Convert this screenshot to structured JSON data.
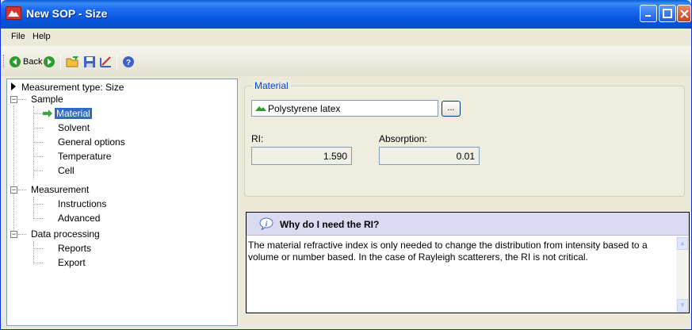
{
  "window": {
    "title": "New SOP - Size"
  },
  "menu": [
    "File",
    "Help"
  ],
  "toolbar": {
    "back_label": "Back"
  },
  "tree": {
    "root": "Measurement type: Size",
    "sample": "Sample",
    "sample_items": [
      "Material",
      "Solvent",
      "General options",
      "Temperature",
      "Cell"
    ],
    "measurement": "Measurement",
    "measurement_items": [
      "Instructions",
      "Advanced"
    ],
    "data_processing": "Data processing",
    "data_processing_items": [
      "Reports",
      "Export"
    ],
    "selected": "Material"
  },
  "material": {
    "group_label": "Material",
    "value": "Polystyrene latex",
    "browse_label": "...",
    "ri_label": "RI:",
    "ri_value": "1.590",
    "absorption_label": "Absorption:",
    "absorption_value": "0.01"
  },
  "help": {
    "title": "Why do I need the RI?",
    "text": "The material refractive index is only needed to change the distribution from intensity based to a volume or number based.  In the case of Rayleigh scatterers, the RI is not critical."
  },
  "colors": {
    "title_bar": "#0a5fd8",
    "selection": "#316ac5",
    "group_label": "#0046d5",
    "help_header": "#dadaf0"
  }
}
